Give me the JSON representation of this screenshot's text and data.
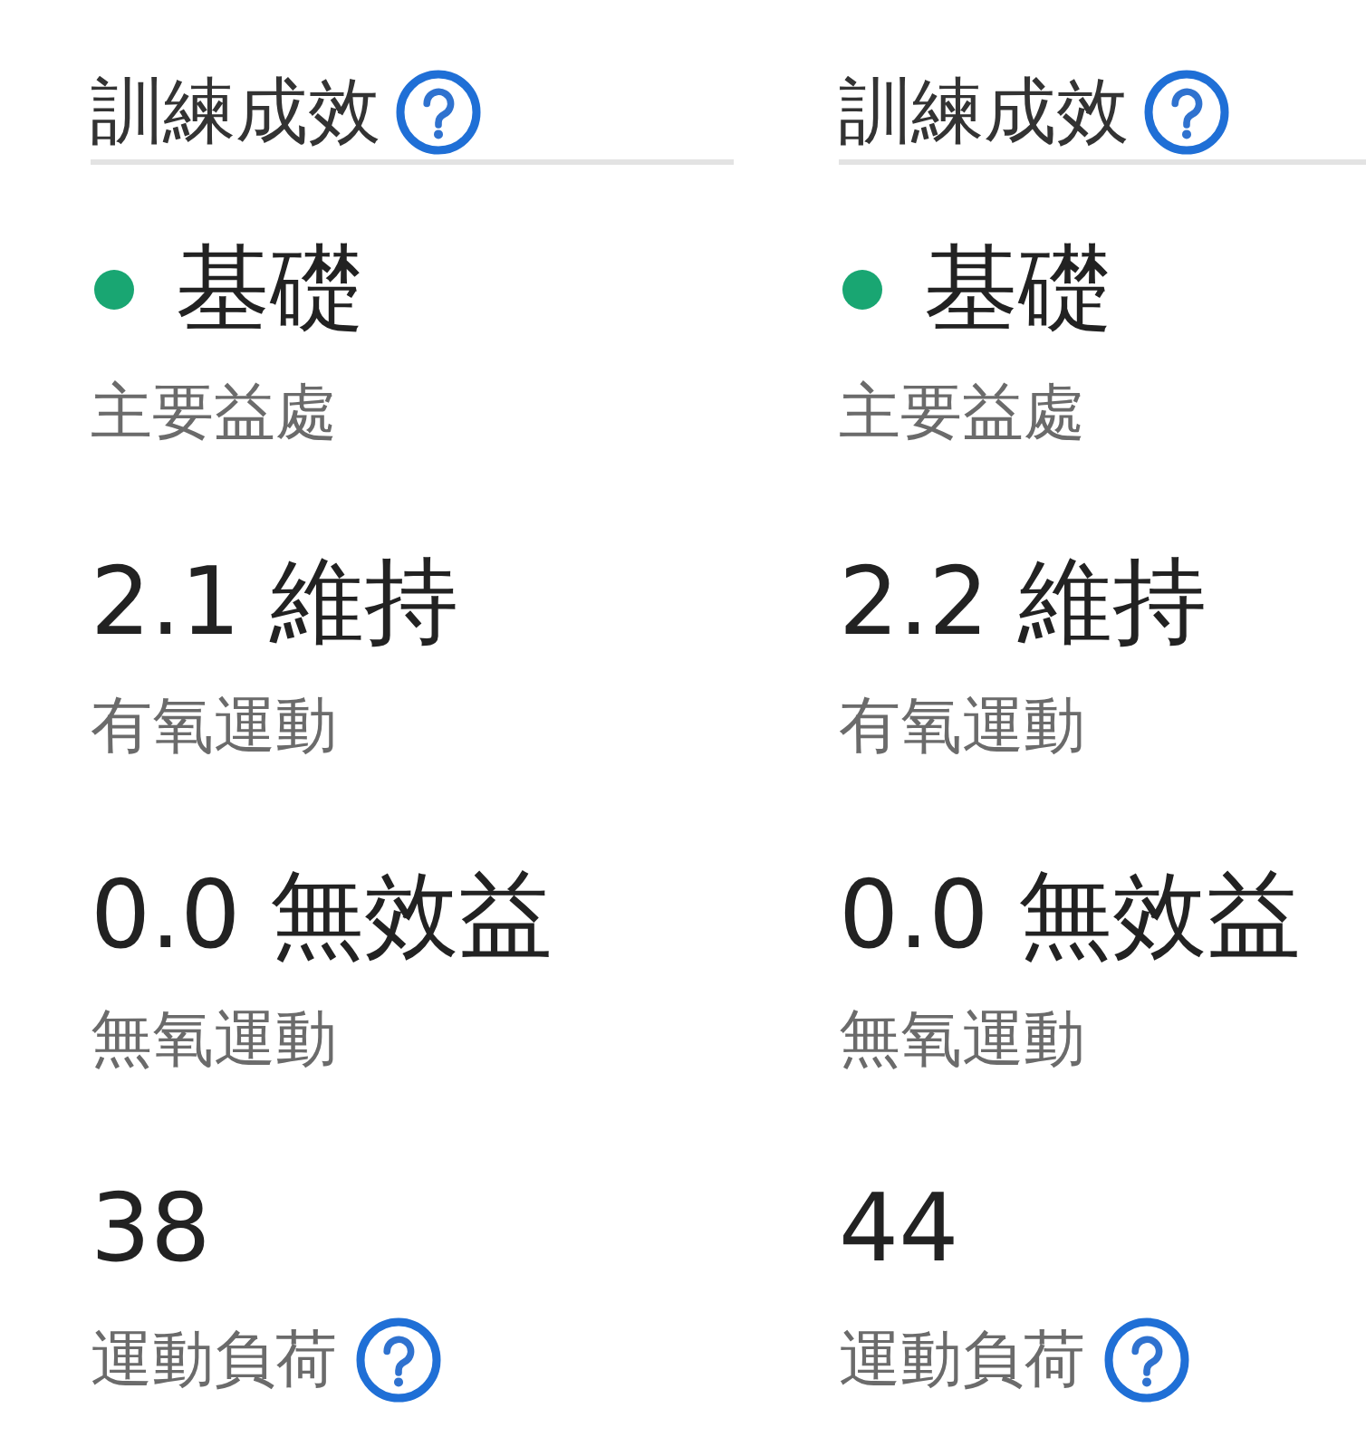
{
  "panels": [
    {
      "title": "訓練成效",
      "items": [
        {
          "kind": "status",
          "value": "基礎",
          "color": "#19a672",
          "label": "主要益處"
        },
        {
          "kind": "plain",
          "value": "2.1 維持",
          "label": "有氧運動"
        },
        {
          "kind": "plain",
          "value": "0.0 無效益",
          "label": "無氧運動"
        },
        {
          "kind": "with_help",
          "value": "38",
          "label": "運動負荷"
        }
      ]
    },
    {
      "title": "訓練成效",
      "items": [
        {
          "kind": "status",
          "value": "基礎",
          "color": "#19a672",
          "label": "主要益處"
        },
        {
          "kind": "plain",
          "value": "2.2 維持",
          "label": "有氧運動"
        },
        {
          "kind": "plain",
          "value": "0.0 無效益",
          "label": "無氧運動"
        },
        {
          "kind": "with_help",
          "value": "44",
          "label": "運動負荷"
        }
      ]
    }
  ]
}
